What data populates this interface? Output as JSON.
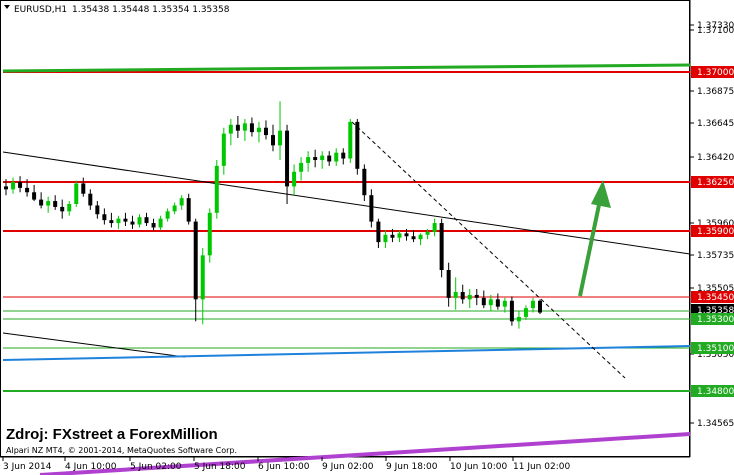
{
  "header": {
    "symbol": "EURUSD,H1",
    "ohlc": "1.35438 1.35448 1.35354 1.35358"
  },
  "watermark": {
    "source": "Zdroj: FXstreet a ForexMillion",
    "copyright": "Alpari NZ MT4, © 2001-2014, MetaQuotes Software Corp."
  },
  "price_axis": [
    "1.37330",
    "1.37100",
    "1.36875",
    "1.36645",
    "1.36420",
    "1.35960",
    "1.35735",
    "1.35505",
    "1.35050",
    "1.34565"
  ],
  "time_axis": [
    "3 Jun 2014",
    "4 Jun 10:00",
    "5 Jun 02:00",
    "5 Jun 18:00",
    "6 Jun 10:00",
    "9 Jun 02:00",
    "9 Jun 18:00",
    "10 Jun 10:00",
    "11 Jun 02:00"
  ],
  "level_tags": {
    "r1": "1.37000",
    "r2": "1.36250",
    "r3": "1.35900",
    "r4": "1.35450",
    "current": "1.35358",
    "s1": "1.35300",
    "s2": "1.35100",
    "s3": "1.34800"
  },
  "colors": {
    "bull": "#00c800",
    "bear": "#000000",
    "resistance": "#e00000",
    "support": "#22aa22",
    "trend_blue": "#1e82dc",
    "trend_purple": "#b040d0"
  },
  "candles": [
    [
      1.3622,
      1.3627,
      1.3616,
      1.362
    ],
    [
      1.362,
      1.3628,
      1.3617,
      1.3625
    ],
    [
      1.3625,
      1.3629,
      1.3618,
      1.3621
    ],
    [
      1.3621,
      1.3627,
      1.3615,
      1.3618
    ],
    [
      1.3618,
      1.3623,
      1.3612,
      1.3613
    ],
    [
      1.3613,
      1.3618,
      1.3607,
      1.3609
    ],
    [
      1.3609,
      1.3615,
      1.3604,
      1.3612
    ],
    [
      1.3612,
      1.3616,
      1.3606,
      1.3608
    ],
    [
      1.3608,
      1.3613,
      1.36,
      1.3605
    ],
    [
      1.3605,
      1.3612,
      1.3602,
      1.361
    ],
    [
      1.361,
      1.3626,
      1.3608,
      1.3624
    ],
    [
      1.3624,
      1.3628,
      1.3615,
      1.3617
    ],
    [
      1.3617,
      1.362,
      1.3606,
      1.3609
    ],
    [
      1.3609,
      1.3612,
      1.36,
      1.3603
    ],
    [
      1.3603,
      1.3607,
      1.3596,
      1.3599
    ],
    [
      1.3599,
      1.3604,
      1.3594,
      1.3597
    ],
    [
      1.3597,
      1.3602,
      1.3593,
      1.36
    ],
    [
      1.36,
      1.3604,
      1.3595,
      1.3598
    ],
    [
      1.3598,
      1.3602,
      1.3593,
      1.3596
    ],
    [
      1.3596,
      1.3603,
      1.3594,
      1.3601
    ],
    [
      1.3601,
      1.3604,
      1.3595,
      1.3597
    ],
    [
      1.3597,
      1.36,
      1.3592,
      1.3594
    ],
    [
      1.3594,
      1.3602,
      1.3592,
      1.36
    ],
    [
      1.36,
      1.3607,
      1.3598,
      1.3605
    ],
    [
      1.3605,
      1.3611,
      1.3603,
      1.3609
    ],
    [
      1.3609,
      1.3616,
      1.3606,
      1.3614
    ],
    [
      1.3614,
      1.3617,
      1.3596,
      1.3598
    ],
    [
      1.3598,
      1.36,
      1.353,
      1.3545
    ],
    [
      1.3545,
      1.358,
      1.3528,
      1.3575
    ],
    [
      1.3575,
      1.3607,
      1.357,
      1.3604
    ],
    [
      1.3604,
      1.364,
      1.36,
      1.3636
    ],
    [
      1.3636,
      1.3662,
      1.363,
      1.3658
    ],
    [
      1.3658,
      1.3668,
      1.365,
      1.3664
    ],
    [
      1.3664,
      1.367,
      1.3655,
      1.366
    ],
    [
      1.366,
      1.3668,
      1.3653,
      1.3665
    ],
    [
      1.3665,
      1.3669,
      1.3656,
      1.3659
    ],
    [
      1.3659,
      1.3666,
      1.3652,
      1.3662
    ],
    [
      1.3662,
      1.3667,
      1.3654,
      1.3657
    ],
    [
      1.3657,
      1.3664,
      1.3646,
      1.365
    ],
    [
      1.365,
      1.368,
      1.364,
      1.366
    ],
    [
      1.366,
      1.3664,
      1.361,
      1.3622
    ],
    [
      1.3622,
      1.3637,
      1.3616,
      1.3632
    ],
    [
      1.3632,
      1.3642,
      1.3626,
      1.3638
    ],
    [
      1.3638,
      1.3646,
      1.3632,
      1.3642
    ],
    [
      1.3642,
      1.3647,
      1.3635,
      1.364
    ],
    [
      1.364,
      1.3646,
      1.3634,
      1.3643
    ],
    [
      1.3643,
      1.3646,
      1.3636,
      1.3639
    ],
    [
      1.3639,
      1.3648,
      1.3636,
      1.3645
    ],
    [
      1.3645,
      1.3648,
      1.3637,
      1.3641
    ],
    [
      1.3641,
      1.3668,
      1.3638,
      1.3666
    ],
    [
      1.3666,
      1.3668,
      1.363,
      1.3634
    ],
    [
      1.3634,
      1.3637,
      1.3612,
      1.3616
    ],
    [
      1.3616,
      1.362,
      1.3594,
      1.3598
    ],
    [
      1.3598,
      1.36,
      1.358,
      1.3584
    ],
    [
      1.3584,
      1.3592,
      1.358,
      1.3589
    ],
    [
      1.3589,
      1.3593,
      1.3584,
      1.3587
    ],
    [
      1.3587,
      1.3592,
      1.3584,
      1.359
    ],
    [
      1.359,
      1.3593,
      1.3585,
      1.3588
    ],
    [
      1.3588,
      1.3592,
      1.3584,
      1.3586
    ],
    [
      1.3586,
      1.359,
      1.3582,
      1.3589
    ],
    [
      1.3589,
      1.3593,
      1.3586,
      1.3591
    ],
    [
      1.3591,
      1.36,
      1.3588,
      1.3597
    ],
    [
      1.3597,
      1.36,
      1.356,
      1.3565
    ],
    [
      1.3565,
      1.357,
      1.354,
      1.3546
    ],
    [
      1.3546,
      1.356,
      1.3538,
      1.355
    ],
    [
      1.355,
      1.3555,
      1.3542,
      1.3545
    ],
    [
      1.3545,
      1.3552,
      1.3539,
      1.3548
    ],
    [
      1.3548,
      1.3552,
      1.3541,
      1.3546
    ],
    [
      1.3546,
      1.3551,
      1.3539,
      1.3541
    ],
    [
      1.3541,
      1.3548,
      1.3537,
      1.3545
    ],
    [
      1.3545,
      1.3549,
      1.3538,
      1.354
    ],
    [
      1.354,
      1.3546,
      1.3536,
      1.3544
    ],
    [
      1.3544,
      1.3547,
      1.3527,
      1.353
    ],
    [
      1.353,
      1.3537,
      1.3525,
      1.3533
    ],
    [
      1.3533,
      1.3541,
      1.3531,
      1.3539
    ],
    [
      1.3539,
      1.3546,
      1.3536,
      1.3544
    ],
    [
      1.3544,
      1.3545,
      1.3535,
      1.3536
    ]
  ]
}
